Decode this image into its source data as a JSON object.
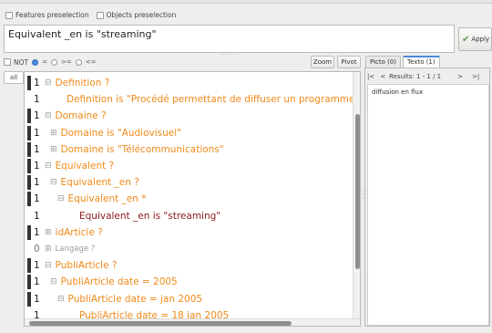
{
  "preselection": {
    "features": "Features preselection",
    "objects": "Objects preselection"
  },
  "query": {
    "text": "Equivalent _en is \"streaming\"",
    "apply_label": "Apply",
    "grip": "....."
  },
  "filter": {
    "not": "NOT",
    "eq": "=",
    "ge": ">=",
    "le": "<=",
    "selected": "="
  },
  "buttons": {
    "zoom": "Zoom",
    "pivot": "Pivot",
    "all": "all"
  },
  "tree": {
    "rows": [
      {
        "count": "1",
        "toggle": "⊟",
        "label": "Definition ?",
        "style": "o"
      },
      {
        "count": "1",
        "toggle": "",
        "label": "Definition is \"Procédé permettant de diffuser un programme",
        "style": "o"
      },
      {
        "count": "1",
        "toggle": "⊟",
        "label": "Domaine ?",
        "style": "o"
      },
      {
        "count": "1",
        "toggle": "⊞",
        "label": "Domaine is \"Audiovisuel\"",
        "style": "o"
      },
      {
        "count": "1",
        "toggle": "⊞",
        "label": "Domaine is \"Télécommunications\"",
        "style": "o"
      },
      {
        "count": "1",
        "toggle": "⊟",
        "label": "Equivalent ?",
        "style": "o"
      },
      {
        "count": "1",
        "toggle": "⊟",
        "label": "Equivalent _en ?",
        "style": "o"
      },
      {
        "count": "1",
        "toggle": "⊟",
        "label": "Equivalent _en *",
        "style": "o"
      },
      {
        "count": "1",
        "toggle": "",
        "label": "Equivalent _en is \"streaming\"",
        "style": "d"
      },
      {
        "count": "1",
        "toggle": "⊞",
        "label": "idArticle ?",
        "style": "o"
      },
      {
        "count": "0",
        "toggle": "⊞",
        "label": "Langage ?",
        "style": "g"
      },
      {
        "count": "1",
        "toggle": "⊟",
        "label": "PubliArticle ?",
        "style": "o"
      },
      {
        "count": "1",
        "toggle": "⊟",
        "label": "PubliArticle date = 2005",
        "style": "o"
      },
      {
        "count": "1",
        "toggle": "⊟",
        "label": "PubliArticle date = jan 2005",
        "style": "o"
      },
      {
        "count": "1",
        "toggle": "",
        "label": "PubliArticle date = 18 jan 2005",
        "style": "o"
      }
    ]
  },
  "right": {
    "tabs": [
      "Picto (0)",
      "Texto (1)"
    ],
    "active_tab": "Texto (1)",
    "nav": {
      "first": "|<",
      "prev": "<",
      "results": "Results: 1 - 1 / 1",
      "next": ">",
      "last": ">|"
    },
    "content": "diffusion en flux"
  },
  "colors": {
    "feature": "#ef8a1a",
    "selected_value": "#8b1a1a",
    "empty_feature": "#9a9a9a",
    "apply_check": "#55a24a",
    "radio_on": "#4a89dc"
  }
}
